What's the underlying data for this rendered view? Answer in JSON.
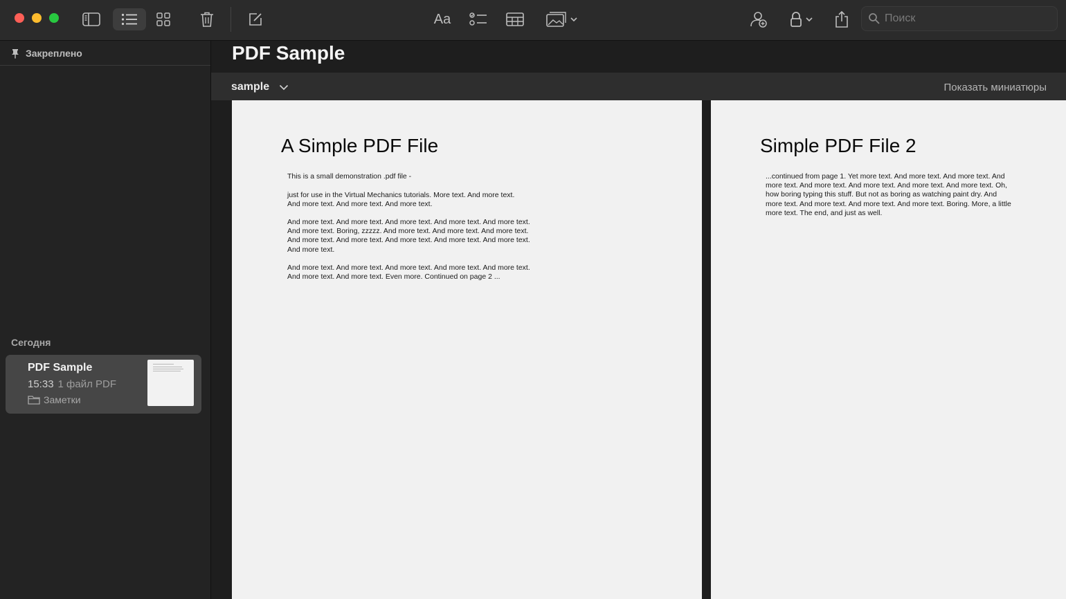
{
  "toolbar": {
    "font_label": "Aa",
    "search_placeholder": "Поиск"
  },
  "sidebar": {
    "pinned_label": "Закреплено",
    "section_today": "Сегодня",
    "note": {
      "title": "PDF Sample",
      "time": "15:33",
      "subtitle": "1 файл PDF",
      "folder": "Заметки"
    }
  },
  "main": {
    "title": "PDF Sample",
    "attachment_name": "sample",
    "show_thumbnails": "Показать миниатюры",
    "pages": [
      {
        "title": "A Simple PDF File",
        "paragraphs": [
          "This is a small demonstration .pdf file -",
          "just for use in the Virtual Mechanics tutorials. More text. And more text. And more text. And more text. And more text.",
          "And more text. And more text. And more text. And more text. And more text. And more text. Boring, zzzzz. And more text. And more text. And more text. And more text. And more text. And more text. And more text. And more text. And more text.",
          "And more text. And more text. And more text. And more text. And more text. And more text. And more text. Even more. Continued on page 2 ..."
        ]
      },
      {
        "title": "Simple PDF File 2",
        "paragraphs": [
          "...continued from page 1. Yet more text. And more text. And more text. And more text. And more text. And more text. And more text. And more text. Oh, how boring typing this stuff. But not as boring as watching paint dry. And more text. And more text. And more text. And more text. Boring.  More, a little more text. The end, and just as well."
        ]
      }
    ]
  },
  "colors": {
    "toolbar_bg": "#2b2b2b",
    "sidebar_bg": "#232323",
    "selected_note_bg": "#464646",
    "page_bg": "#f1f1f1"
  }
}
